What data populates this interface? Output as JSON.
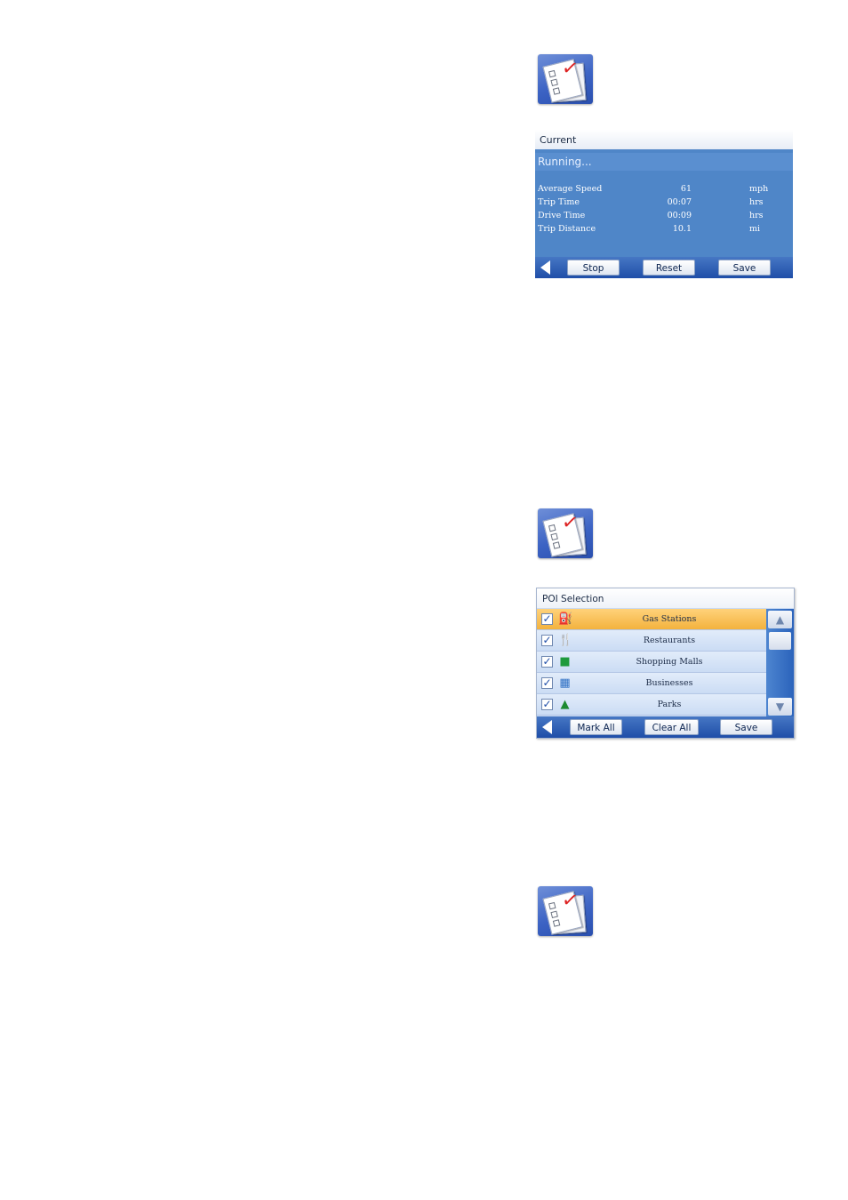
{
  "trip_computer": {
    "title": "Current",
    "status": "Running...",
    "stats": [
      {
        "label": "Average Speed",
        "value": "61",
        "unit": "mph"
      },
      {
        "label": "Trip Time",
        "value": "00:07",
        "unit": "hrs"
      },
      {
        "label": "Drive Time",
        "value": "00:09",
        "unit": "hrs"
      },
      {
        "label": "Trip Distance",
        "value": "10.1",
        "unit": "mi"
      }
    ],
    "buttons": {
      "stop": "Stop",
      "reset": "Reset",
      "save": "Save"
    }
  },
  "poi_selection": {
    "title": "POI Selection",
    "items": [
      {
        "name": "Gas Stations",
        "icon": "gas-pump-icon",
        "checked": true,
        "selected": true
      },
      {
        "name": "Restaurants",
        "icon": "fork-knife-icon",
        "checked": true
      },
      {
        "name": "Shopping Malls",
        "icon": "shopping-bag-icon",
        "checked": true
      },
      {
        "name": "Businesses",
        "icon": "building-icon",
        "checked": true
      },
      {
        "name": "Parks",
        "icon": "tree-icon",
        "checked": true
      }
    ],
    "buttons": {
      "mark_all": "Mark All",
      "clear_all": "Clear All",
      "save": "Save"
    }
  },
  "colors": {
    "panel_blue": "#4f86c8",
    "selected_row": "#f3b23e",
    "toolbar": "#1f4ea8"
  }
}
